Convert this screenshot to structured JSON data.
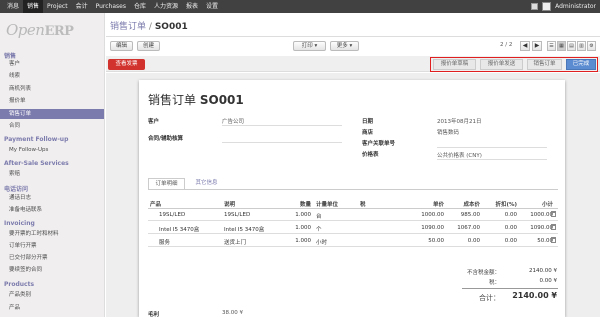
{
  "topbar": {
    "menus": [
      "消息",
      "销售",
      "Project",
      "会计",
      "Purchases",
      "仓库",
      "人力资源",
      "报表",
      "设置"
    ],
    "active_index": 1,
    "user": "Administrator"
  },
  "logo": {
    "prefix": "Open",
    "suffix": "ERP"
  },
  "sidebar": {
    "groups": [
      {
        "label": "销售",
        "items": [
          "客户",
          "线索",
          "商机列表",
          "报价单",
          "销售订单",
          "合同"
        ]
      },
      {
        "label": "Payment Follow-up",
        "items": [
          "My Follow-Ups"
        ]
      },
      {
        "label": "After-Sale Services",
        "items": [
          "索赔"
        ]
      },
      {
        "label": "电话访问",
        "items": [
          "通话日志",
          "准备电话联系"
        ]
      },
      {
        "label": "Invoicing",
        "items": [
          "要开票的工时和材料",
          "订单行开票",
          "已交付部分开票",
          "要续签的合同"
        ]
      },
      {
        "label": "Products",
        "items": [
          "产品类别",
          "产品"
        ]
      }
    ],
    "active_item": "销售订单"
  },
  "header": {
    "breadcrumb_parent": "销售订单",
    "breadcrumb_sep": "/",
    "breadcrumb_current": "SO001",
    "edit": "编辑",
    "create": "创建",
    "print": "打印 ▾",
    "more": "更多 ▾",
    "pager": "2 / 2",
    "prev": "◀",
    "next": "▶",
    "views": [
      "☰",
      "▦",
      "▤",
      "▥",
      "⚙"
    ]
  },
  "status": {
    "invoice_button": "查看发票",
    "steps": [
      "报价单草稿",
      "报价单发送",
      "销售订单",
      "已完成"
    ],
    "active_step": 3
  },
  "form": {
    "title_prefix": "销售订单",
    "title_number": "SO001",
    "customer_label": "客户",
    "customer_value": "广告公司",
    "contract_label": "合同/辅助核算",
    "date_label": "日期",
    "date_value": "2013年08月21日",
    "shop_label": "商店",
    "shop_value": "销售数码",
    "customer_ref_label": "客户关联单号",
    "pricelist_label": "价格表",
    "pricelist_value": "公共价格表 (CNY)"
  },
  "tabs": [
    "订单明细",
    "其它信息"
  ],
  "table": {
    "headers": [
      "产品",
      "说明",
      "数量",
      "计量单位",
      "税",
      "单价",
      "成本价",
      "折扣(%)",
      "小计"
    ],
    "rows": [
      [
        "19SL/LED",
        "19SL/LED",
        "1.000",
        "台",
        "",
        "1000.00",
        "985.00",
        "0.00",
        "1000.00"
      ],
      [
        "Intel I5 3470盒",
        "Intel I5 3470盒",
        "1.000",
        "个",
        "",
        "1090.00",
        "1067.00",
        "0.00",
        "1090.00"
      ],
      [
        "服务",
        "送货上门",
        "1.000",
        "小时",
        "",
        "50.00",
        "0.00",
        "0.00",
        "50.00"
      ]
    ]
  },
  "totals": {
    "untaxed_label": "不含税金额：",
    "untaxed_value": "2140.00 ¥",
    "tax_label": "税：",
    "tax_value": "0.00 ¥",
    "total_label": "合计：",
    "total_value": "2140.00 ¥"
  },
  "margin": {
    "label": "毛利",
    "value": "38.00 ¥"
  }
}
